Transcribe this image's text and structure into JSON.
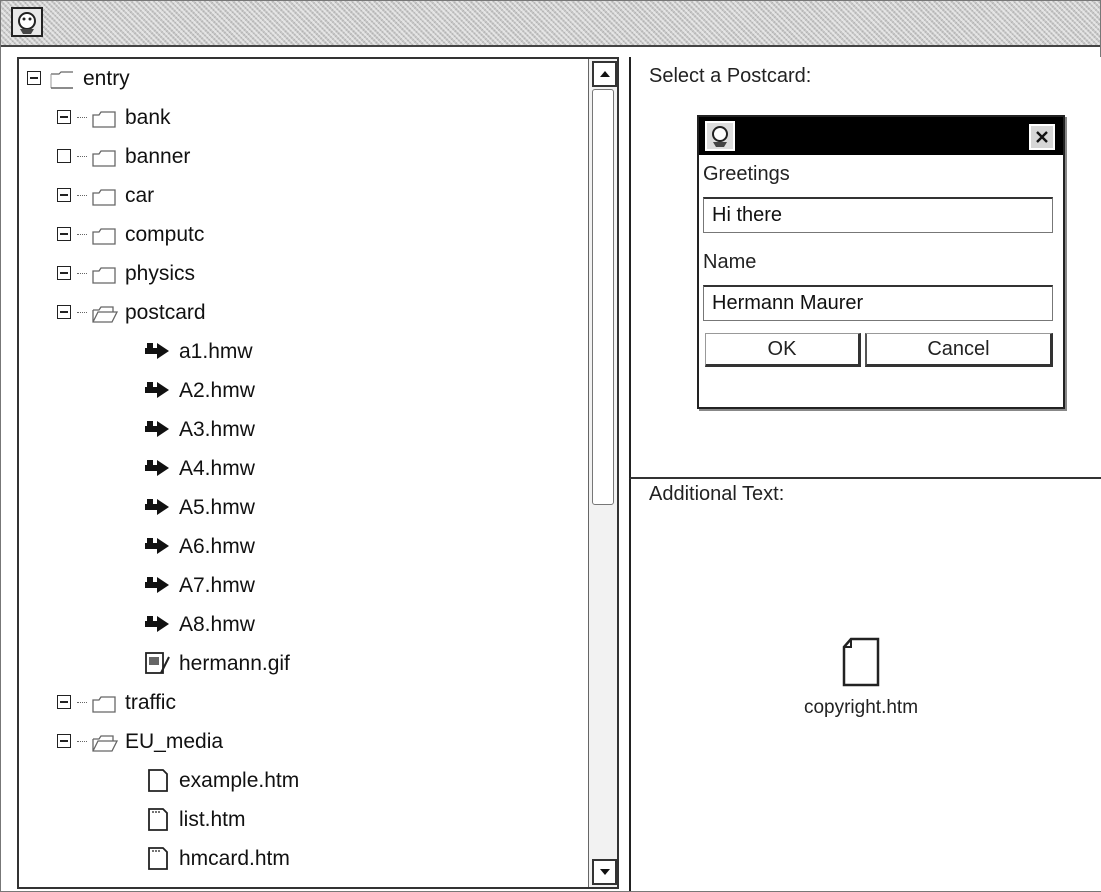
{
  "window": {
    "title": ""
  },
  "tree": {
    "root": {
      "label": "entry"
    },
    "items": [
      {
        "label": "bank"
      },
      {
        "label": "banner"
      },
      {
        "label": "car"
      },
      {
        "label": "computc"
      },
      {
        "label": "physics"
      },
      {
        "label": "postcard"
      },
      {
        "label": "a1.hmw"
      },
      {
        "label": "A2.hmw"
      },
      {
        "label": "A3.hmw"
      },
      {
        "label": "A4.hmw"
      },
      {
        "label": "A5.hmw"
      },
      {
        "label": "A6.hmw"
      },
      {
        "label": "A7.hmw"
      },
      {
        "label": "A8.hmw"
      },
      {
        "label": "hermann.gif"
      },
      {
        "label": "traffic"
      },
      {
        "label": "EU_media"
      },
      {
        "label": "example.htm"
      },
      {
        "label": "list.htm"
      },
      {
        "label": "hmcard.htm"
      }
    ]
  },
  "postcard_pane": {
    "heading": "Select a Postcard:",
    "dialog": {
      "greetings_label": "Greetings",
      "greetings_value": "Hi there",
      "name_label": "Name",
      "name_value": "Hermann Maurer",
      "ok_label": "OK",
      "cancel_label": "Cancel"
    }
  },
  "info_pane": {
    "heading": "Additional Text:",
    "file_name": "copyright.htm"
  }
}
